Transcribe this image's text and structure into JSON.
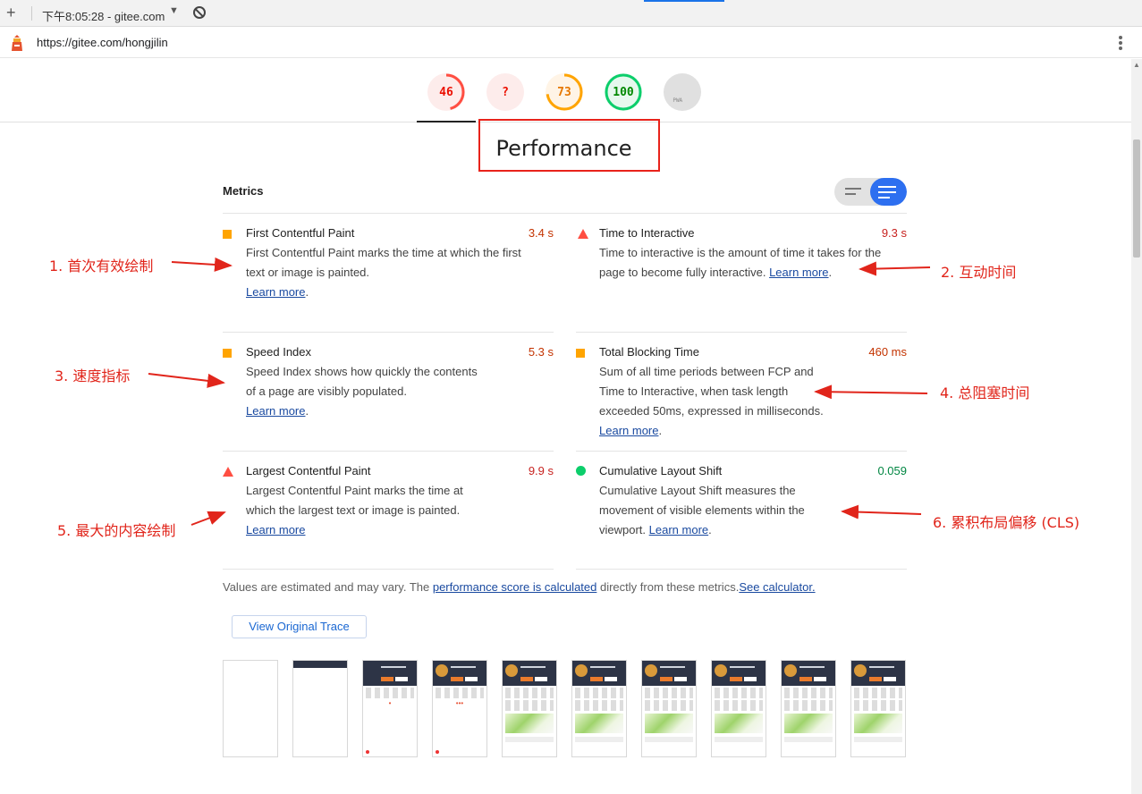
{
  "browser": {
    "tab_text": "下午8:05:28 - gitee.com",
    "url": "https://gitee.com/hongjilin"
  },
  "gauges": [
    {
      "label": "46",
      "color": "#ff4e42"
    },
    {
      "label": "?",
      "color": "#ff4e42"
    },
    {
      "label": "73",
      "color": "#ffa400"
    },
    {
      "label": "100",
      "color": "#0cce6b"
    },
    {
      "label": "PWA",
      "color": "#9e9e9e"
    }
  ],
  "section_title": "Performance",
  "metrics_heading": "Metrics",
  "metrics": [
    {
      "icon": "orange-square-icon",
      "title": "First Contentful Paint",
      "value": "3.4 s",
      "desc": "First Contentful Paint marks the time at which the first text or image is painted.",
      "link": "Learn more"
    },
    {
      "icon": "red-triangle-icon",
      "title": "Time to Interactive",
      "value": "9.3 s",
      "desc": "Time to interactive is the amount of time it takes for the page to become fully interactive.",
      "link": "Learn more"
    },
    {
      "icon": "orange-square-icon",
      "title": "Speed Index",
      "value": "5.3 s",
      "desc": "Speed Index shows how quickly the contents of a page are visibly populated.",
      "link": "Learn more"
    },
    {
      "icon": "orange-square-icon",
      "title": "Total Blocking Time",
      "value": "460 ms",
      "desc": "Sum of all time periods between FCP and Time to Interactive, when task length exceeded 50ms, expressed in milliseconds.",
      "link": "Learn more"
    },
    {
      "icon": "red-triangle-icon",
      "title": "Largest Contentful Paint",
      "value": "9.9 s",
      "desc": "Largest Contentful Paint marks the time at which the largest text or image is painted.",
      "link": "Learn more"
    },
    {
      "icon": "green-circle-icon",
      "title": "Cumulative Layout Shift",
      "value": "0.059",
      "desc": "Cumulative Layout Shift measures the movement of visible elements within the viewport.",
      "link": "Learn more"
    }
  ],
  "note": {
    "prefix": "Values are estimated and may vary. The ",
    "link1": "performance score is calculated",
    "middle": " directly from these metrics.",
    "link2": "See calculator."
  },
  "trace_button": "View Original Trace",
  "annotations": [
    "1. 首次有效绘制",
    "2. 互动时间",
    "3. 速度指标",
    "4. 总阻塞时间",
    "5. 最大的内容绘制",
    "6. 累积布局偏移 (CLS)"
  ]
}
